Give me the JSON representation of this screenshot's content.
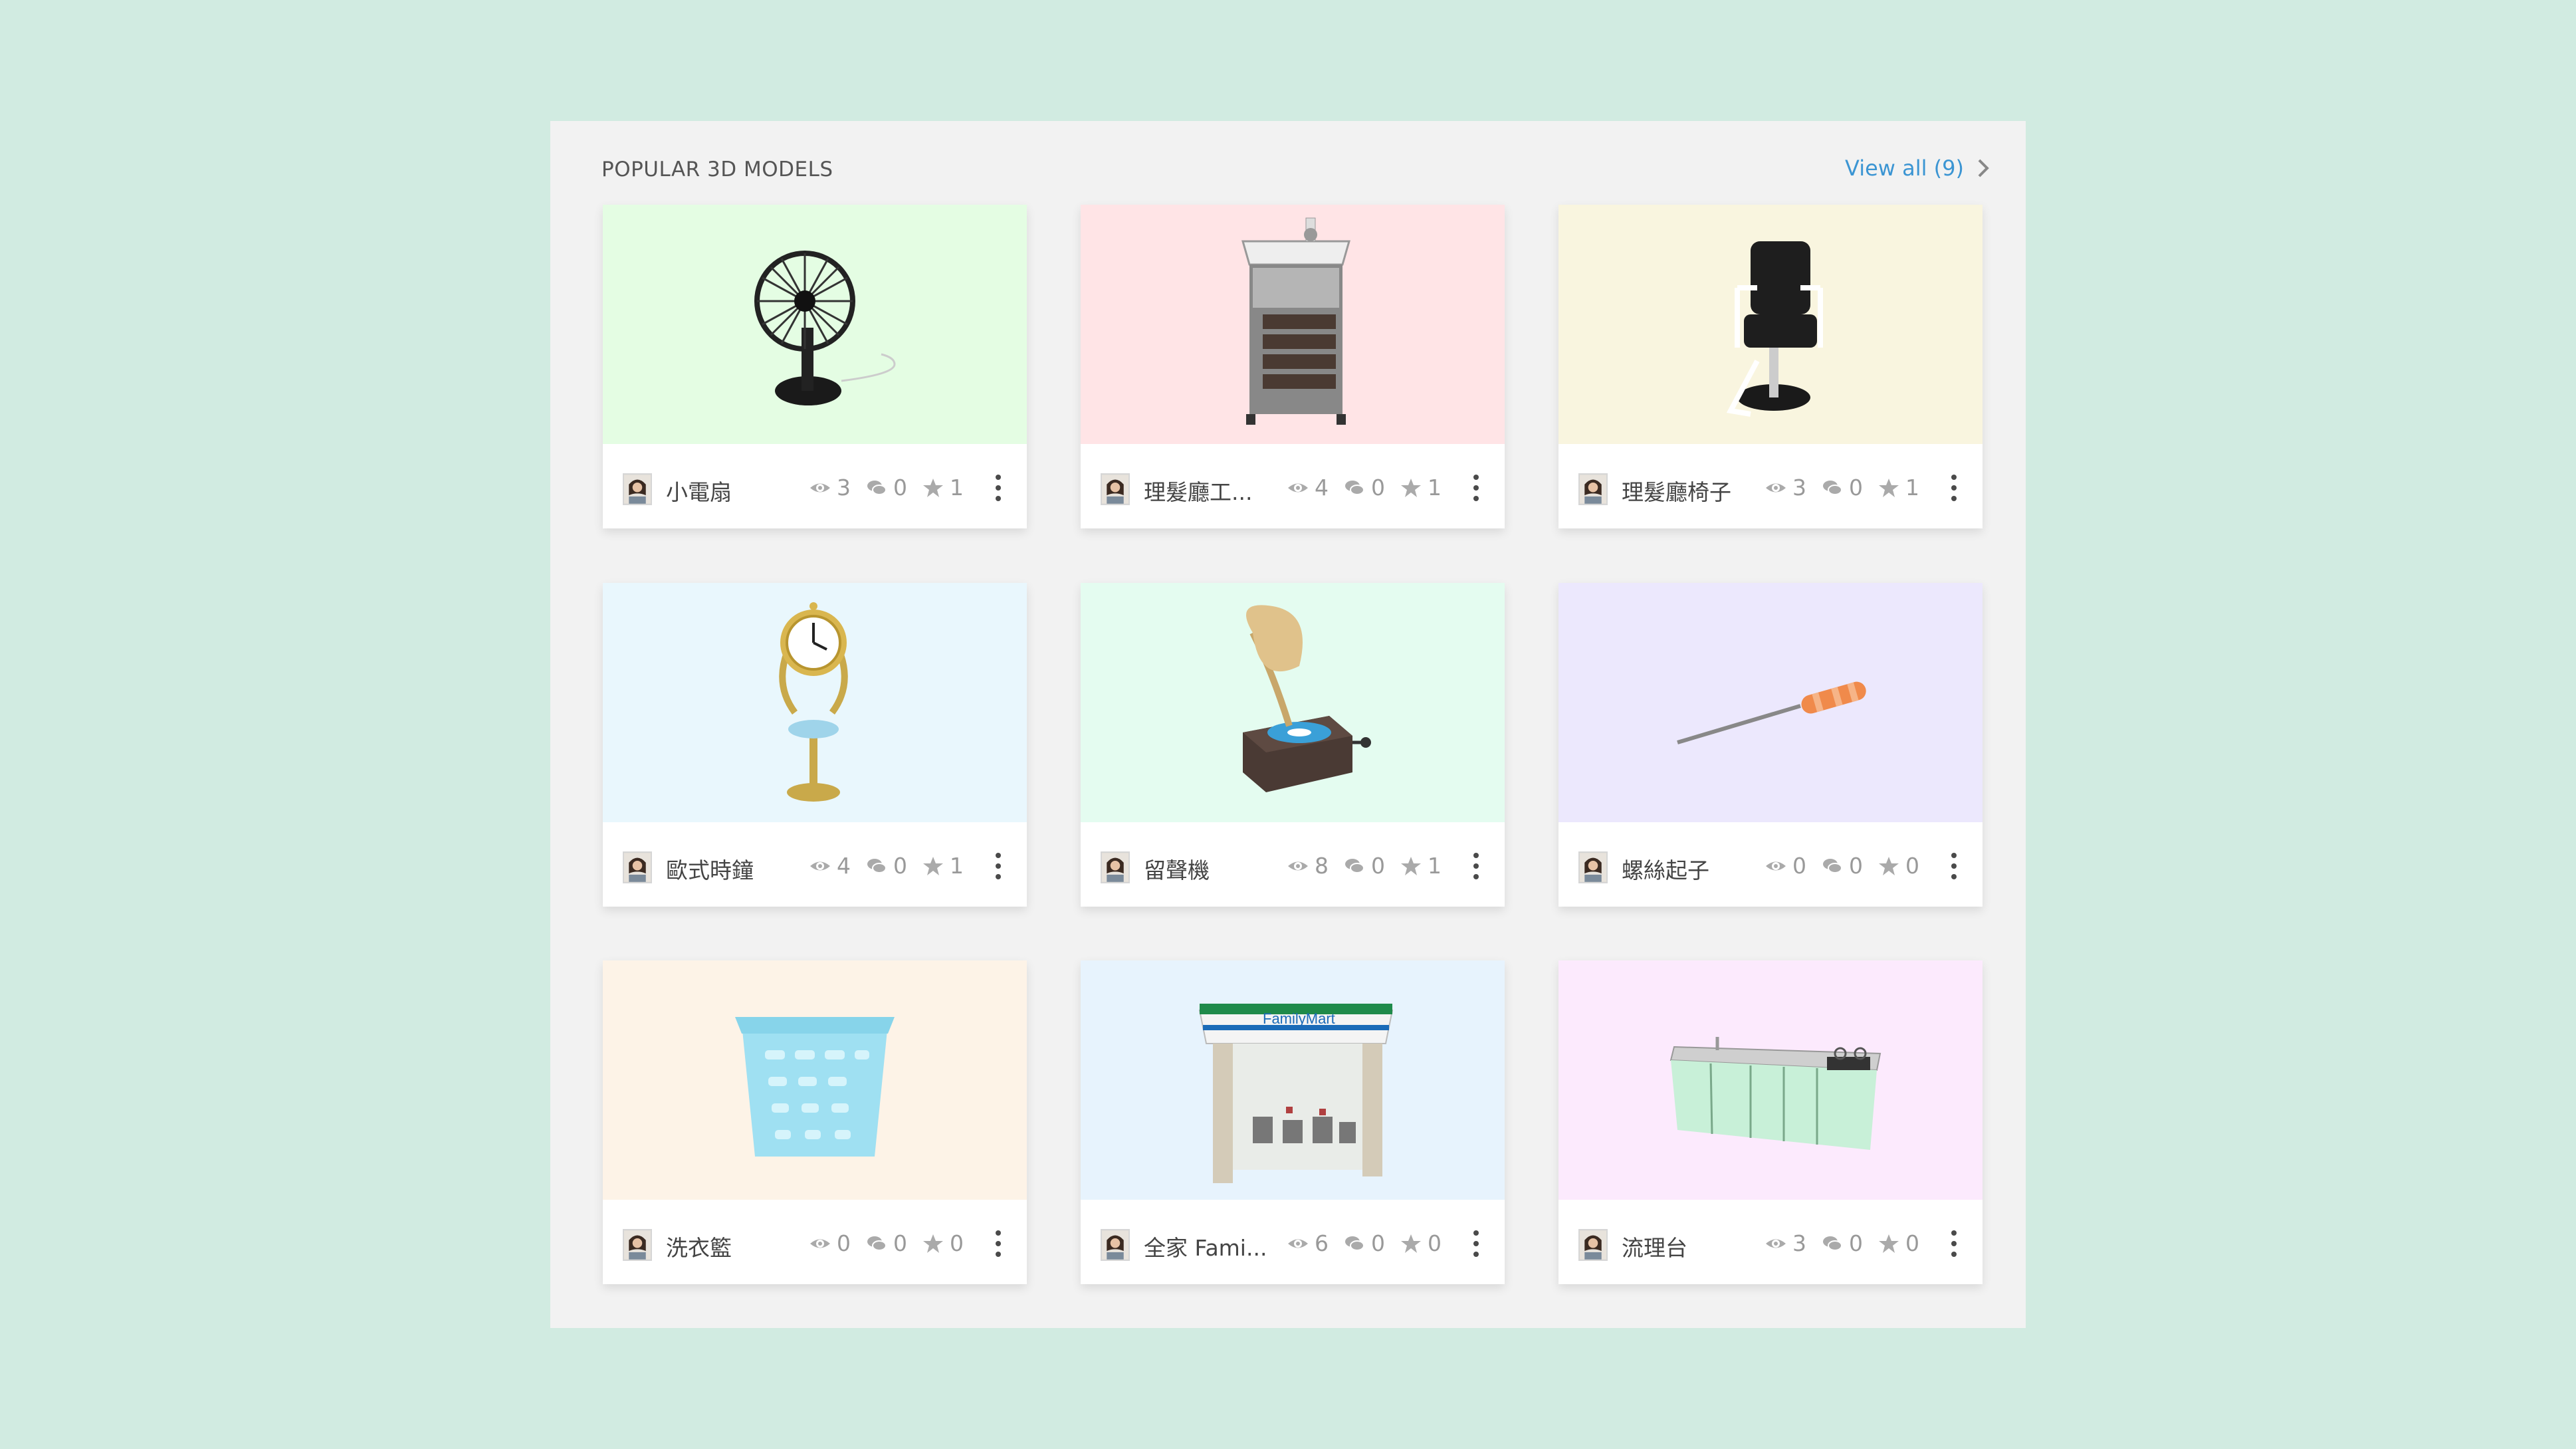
{
  "section": {
    "title": "POPULAR 3D MODELS",
    "view_all_label": "View all (9)"
  },
  "models": [
    {
      "name": "小電扇",
      "views": "3",
      "comments": "0",
      "likes": "1",
      "bg": "#e4fde3",
      "icon": "electric-fan"
    },
    {
      "name": "理髮廳工...",
      "views": "4",
      "comments": "0",
      "likes": "1",
      "bg": "#ffe4e6",
      "icon": "salon-trolley"
    },
    {
      "name": "理髮廳椅子",
      "views": "3",
      "comments": "0",
      "likes": "1",
      "bg": "#f9f5df",
      "icon": "barber-chair"
    },
    {
      "name": "歐式時鐘",
      "views": "4",
      "comments": "0",
      "likes": "1",
      "bg": "#e9f7fd",
      "icon": "european-clock"
    },
    {
      "name": "留聲機",
      "views": "8",
      "comments": "0",
      "likes": "1",
      "bg": "#e4fcf0",
      "icon": "gramophone"
    },
    {
      "name": "螺絲起子",
      "views": "0",
      "comments": "0",
      "likes": "0",
      "bg": "#ece8fd",
      "icon": "screwdriver"
    },
    {
      "name": "洗衣籃",
      "views": "0",
      "comments": "0",
      "likes": "0",
      "bg": "#fdf3e7",
      "icon": "laundry-basket"
    },
    {
      "name": "全家 Fami...",
      "views": "6",
      "comments": "0",
      "likes": "0",
      "bg": "#e7f3fd",
      "icon": "familymart-store",
      "sign_text": "FamilyMart"
    },
    {
      "name": "流理台",
      "views": "3",
      "comments": "0",
      "likes": "0",
      "bg": "#fceafd",
      "icon": "kitchen-counter"
    }
  ]
}
